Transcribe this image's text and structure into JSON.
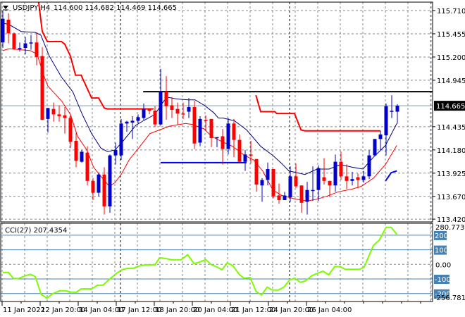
{
  "chart_data": {
    "type": "candlestick",
    "header": {
      "symbol_timeframe": "USDJPY,H4",
      "ohlc_text": "114.600 114.682 114.469 114.665"
    },
    "colors": {
      "bull": "#0000c8",
      "bear": "#ff0000",
      "ma_fast": "#000080",
      "ma_slow": "#ff0000",
      "step_line": "#ff0000",
      "resistance": "#000000",
      "support": "#0000ff",
      "cci": "#7cfc00",
      "cci_levels": "#4682b4",
      "grid": "#7f8a99"
    },
    "price_axis": {
      "range": [
        113.42,
        115.71
      ],
      "ticks": [
        "115.710",
        "115.455",
        "115.200",
        "114.945",
        "114.435",
        "114.180",
        "113.925",
        "113.670",
        "113.420"
      ],
      "tick_values": [
        115.71,
        115.455,
        115.2,
        114.945,
        114.435,
        114.18,
        113.925,
        113.67,
        113.42
      ],
      "current_price": "114.665",
      "current_value": 114.665
    },
    "time_axis": {
      "labels": [
        "11 Jan 2022",
        "12 Jan 20:00",
        "14 Jan 04:00",
        "17 Jan 12:00",
        "18 Jan 20:00",
        "20 Jan 04:00",
        "21 Jan 12:00",
        "24 Jan 20:00",
        "26 Jan 04:00"
      ]
    },
    "candles_ohlc": [
      [
        115.36,
        115.71,
        115.3,
        115.62
      ],
      [
        115.61,
        115.68,
        115.35,
        115.46
      ],
      [
        115.46,
        115.47,
        115.28,
        115.29
      ],
      [
        115.29,
        115.36,
        115.26,
        115.3
      ],
      [
        115.3,
        115.42,
        115.23,
        115.35
      ],
      [
        115.35,
        115.44,
        115.28,
        115.36
      ],
      [
        115.36,
        115.47,
        115.11,
        115.2
      ],
      [
        115.21,
        115.31,
        114.51,
        114.51
      ],
      [
        114.52,
        114.64,
        114.37,
        114.64
      ],
      [
        114.63,
        114.7,
        114.49,
        114.57
      ],
      [
        114.57,
        114.67,
        114.49,
        114.55
      ],
      [
        114.56,
        114.65,
        114.36,
        114.53
      ],
      [
        114.53,
        114.56,
        114.2,
        114.27
      ],
      [
        114.28,
        114.37,
        113.99,
        114.06
      ],
      [
        114.05,
        114.18,
        114.04,
        114.16
      ],
      [
        114.15,
        114.22,
        113.79,
        113.84
      ],
      [
        113.84,
        113.87,
        113.63,
        113.71
      ],
      [
        113.71,
        113.93,
        113.67,
        113.91
      ],
      [
        113.91,
        113.99,
        113.47,
        113.56
      ],
      [
        113.56,
        114.13,
        113.49,
        114.12
      ],
      [
        114.12,
        114.26,
        114.02,
        114.18
      ],
      [
        114.12,
        114.52,
        114.07,
        114.47
      ],
      [
        114.47,
        114.5,
        114.38,
        114.49
      ],
      [
        114.48,
        114.55,
        114.3,
        114.5
      ],
      [
        114.5,
        114.57,
        114.47,
        114.54
      ],
      [
        114.53,
        114.69,
        114.51,
        114.63
      ],
      [
        114.63,
        114.63,
        114.57,
        114.61
      ],
      [
        114.61,
        114.66,
        114.43,
        114.46
      ],
      [
        114.46,
        115.07,
        114.45,
        114.82
      ],
      [
        114.82,
        114.99,
        114.51,
        114.66
      ],
      [
        114.67,
        114.76,
        114.53,
        114.62
      ],
      [
        114.63,
        114.7,
        114.46,
        114.58
      ],
      [
        114.58,
        114.7,
        114.52,
        114.57
      ],
      [
        114.6,
        114.75,
        114.53,
        114.65
      ],
      [
        114.65,
        114.72,
        114.19,
        114.25
      ],
      [
        114.26,
        114.55,
        114.22,
        114.52
      ],
      [
        114.51,
        114.56,
        114.39,
        114.5
      ],
      [
        114.52,
        114.52,
        114.21,
        114.31
      ],
      [
        114.31,
        114.32,
        114.21,
        114.32
      ],
      [
        114.33,
        114.41,
        114.02,
        114.19
      ],
      [
        114.19,
        114.53,
        114.13,
        114.47
      ],
      [
        114.47,
        114.52,
        114.1,
        114.29
      ],
      [
        114.29,
        114.35,
        114.05,
        114.05
      ],
      [
        114.05,
        114.18,
        113.95,
        114.13
      ],
      [
        114.13,
        114.28,
        114.03,
        114.12
      ],
      [
        114.08,
        114.08,
        113.72,
        113.8
      ],
      [
        113.79,
        113.87,
        113.61,
        113.85
      ],
      [
        113.85,
        114.04,
        113.79,
        113.97
      ],
      [
        113.97,
        113.97,
        113.65,
        113.67
      ],
      [
        113.68,
        113.81,
        113.59,
        113.63
      ],
      [
        113.63,
        113.72,
        113.63,
        113.68
      ],
      [
        113.66,
        114.0,
        113.61,
        113.89
      ],
      [
        113.89,
        114.03,
        113.76,
        113.78
      ],
      [
        113.79,
        113.79,
        113.49,
        113.6
      ],
      [
        113.61,
        113.83,
        113.47,
        113.74
      ],
      [
        113.73,
        114.0,
        113.62,
        113.74
      ],
      [
        113.74,
        114.01,
        113.62,
        113.98
      ],
      [
        113.88,
        114.09,
        113.8,
        113.84
      ],
      [
        113.84,
        113.84,
        113.66,
        113.79
      ],
      [
        113.79,
        114.13,
        113.72,
        114.05
      ],
      [
        114.05,
        114.16,
        113.85,
        113.89
      ],
      [
        113.89,
        114.02,
        113.75,
        113.84
      ],
      [
        113.84,
        113.94,
        113.79,
        113.86
      ],
      [
        113.88,
        113.92,
        113.76,
        113.85
      ],
      [
        113.85,
        113.95,
        113.82,
        113.89
      ],
      [
        113.89,
        114.18,
        113.86,
        114.12
      ],
      [
        114.12,
        114.3,
        114.11,
        114.3
      ],
      [
        114.3,
        114.39,
        114.17,
        114.35
      ],
      [
        114.34,
        114.69,
        114.12,
        114.66
      ],
      [
        114.6,
        114.78,
        114.53,
        114.61
      ],
      [
        114.6,
        114.682,
        114.469,
        114.665
      ]
    ],
    "ma_fast": [
      [
        0,
        115.57
      ],
      [
        1,
        115.56
      ],
      [
        3.25,
        115.48
      ],
      [
        5.75,
        115.47
      ],
      [
        6.75,
        115.44
      ],
      [
        8.25,
        115.21
      ],
      [
        10.4,
        114.98
      ],
      [
        12.4,
        114.82
      ],
      [
        14.1,
        114.57
      ],
      [
        15.75,
        114.36
      ],
      [
        17.4,
        114.2
      ],
      [
        18.6,
        114.16
      ],
      [
        19.9,
        114.18
      ],
      [
        21.1,
        114.26
      ],
      [
        23.6,
        114.45
      ],
      [
        24.9,
        114.5
      ],
      [
        27,
        114.57
      ],
      [
        28.25,
        114.69
      ],
      [
        29.1,
        114.76
      ],
      [
        30.75,
        114.74
      ],
      [
        32.9,
        114.73
      ],
      [
        34.1,
        114.73
      ],
      [
        35.75,
        114.67
      ],
      [
        37.4,
        114.59
      ],
      [
        38.25,
        114.53
      ],
      [
        39.1,
        114.53
      ],
      [
        41.1,
        114.5
      ],
      [
        43.25,
        114.4
      ],
      [
        45.75,
        114.22
      ],
      [
        47.9,
        114.12
      ],
      [
        49.5,
        114.03
      ],
      [
        50.75,
        113.95
      ],
      [
        53.6,
        113.91
      ],
      [
        55.75,
        113.97
      ],
      [
        57.9,
        113.97
      ],
      [
        59.9,
        114.02
      ],
      [
        62,
        113.99
      ],
      [
        63.9,
        113.97
      ],
      [
        65.75,
        114.1
      ],
      [
        67.9,
        114.23
      ],
      [
        69.9,
        114.47
      ]
    ],
    "ma_slow": [
      [
        0,
        115.27
      ],
      [
        1.1,
        115.29
      ],
      [
        4.9,
        115.27
      ],
      [
        6.1,
        115.23
      ],
      [
        7.25,
        115.0
      ],
      [
        8,
        114.88
      ],
      [
        10.4,
        114.72
      ],
      [
        12,
        114.57
      ],
      [
        13.25,
        114.33
      ],
      [
        14.9,
        114.18
      ],
      [
        16.1,
        113.99
      ],
      [
        17.4,
        113.89
      ],
      [
        18.9,
        113.78
      ],
      [
        19.9,
        113.82
      ],
      [
        21.1,
        113.92
      ],
      [
        22.4,
        114.07
      ],
      [
        24.1,
        114.2
      ],
      [
        26.1,
        114.36
      ],
      [
        28.25,
        114.41
      ],
      [
        29.5,
        114.44
      ],
      [
        32.4,
        114.47
      ],
      [
        33.6,
        114.46
      ],
      [
        35.75,
        114.41
      ],
      [
        37,
        114.33
      ],
      [
        38.6,
        114.28
      ],
      [
        40.75,
        114.22
      ],
      [
        42.9,
        114.12
      ],
      [
        44.5,
        114.07
      ],
      [
        46.1,
        113.95
      ],
      [
        47.9,
        113.74
      ],
      [
        49.5,
        113.68
      ],
      [
        52,
        113.64
      ],
      [
        54.1,
        113.62
      ],
      [
        55.75,
        113.64
      ],
      [
        57.4,
        113.67
      ],
      [
        59.5,
        113.72
      ],
      [
        62,
        113.75
      ],
      [
        63.6,
        113.78
      ],
      [
        65.75,
        113.87
      ],
      [
        67.9,
        114.02
      ],
      [
        69.9,
        114.23
      ]
    ],
    "step_line_segments": [
      [
        [
          6.3,
          115.83
        ],
        [
          7,
          115.48
        ],
        [
          7.9,
          115.37
        ],
        [
          10.4,
          115.37
        ],
        [
          11,
          115.34
        ],
        [
          12,
          115.21
        ],
        [
          12.9,
          115.0
        ],
        [
          13.9,
          115.0
        ],
        [
          15.75,
          114.75
        ],
        [
          17,
          114.75
        ],
        [
          18,
          114.64
        ],
        [
          18.6,
          114.63
        ],
        [
          26.75,
          114.63
        ]
      ],
      [
        [
          44.9,
          114.78
        ],
        [
          45.75,
          114.6
        ],
        [
          48.25,
          114.6
        ],
        [
          48.6,
          114.58
        ],
        [
          51.75,
          114.58
        ],
        [
          52.9,
          114.4
        ],
        [
          53.6,
          114.39
        ],
        [
          67,
          114.39
        ]
      ]
    ],
    "resistance_line": {
      "price": 114.82,
      "from_index": 24.9
    },
    "support_line": {
      "price": 114.04,
      "from_index": 28,
      "to_index": 43.25
    },
    "short_blue_line": [
      [
        67.9,
        113.84
      ],
      [
        68.9,
        113.93
      ],
      [
        69.9,
        113.95
      ]
    ],
    "cci": {
      "label": "CCI(27) 207.4354",
      "max_label": "280.7737",
      "min_label": "-256.7818",
      "range": [
        -256.7818,
        280.7737
      ],
      "level_labels": [
        "200",
        "100",
        "0.00",
        "-100",
        "-200"
      ],
      "level_values": [
        200,
        100,
        0,
        -100,
        -200
      ],
      "values": [
        [
          0,
          -55
        ],
        [
          1,
          -55
        ],
        [
          1.9,
          -97
        ],
        [
          2.8,
          -97
        ],
        [
          3.9,
          -79
        ],
        [
          4.9,
          -68
        ],
        [
          5.75,
          -84
        ],
        [
          6.8,
          -205
        ],
        [
          7.8,
          -232
        ],
        [
          8.9,
          -200
        ],
        [
          10.1,
          -181
        ],
        [
          11.2,
          -181
        ],
        [
          12,
          -190
        ],
        [
          13,
          -192
        ],
        [
          13.9,
          -168
        ],
        [
          15.75,
          -168
        ],
        [
          16.8,
          -143
        ],
        [
          17.8,
          -142
        ],
        [
          19.1,
          -95
        ],
        [
          20.3,
          -58
        ],
        [
          21.2,
          -36
        ],
        [
          22,
          -28
        ],
        [
          23.25,
          -26
        ],
        [
          24.1,
          -12
        ],
        [
          25.3,
          -3
        ],
        [
          27,
          -3
        ],
        [
          27.8,
          45
        ],
        [
          28.7,
          42
        ],
        [
          29.9,
          32
        ],
        [
          31.6,
          32
        ],
        [
          32.8,
          66
        ],
        [
          33.9,
          6
        ],
        [
          34.7,
          13
        ],
        [
          36,
          32
        ],
        [
          37,
          -2
        ],
        [
          38,
          -18
        ],
        [
          38.9,
          -36
        ],
        [
          39.8,
          10
        ],
        [
          40.75,
          -7
        ],
        [
          42,
          -71
        ],
        [
          42.8,
          -95
        ],
        [
          43.9,
          -90
        ],
        [
          44.9,
          -184
        ],
        [
          45.9,
          -210
        ],
        [
          46.9,
          -156
        ],
        [
          47.8,
          -176
        ],
        [
          48.9,
          -176
        ],
        [
          49.9,
          -155
        ],
        [
          50.9,
          -106
        ],
        [
          51.8,
          -95
        ],
        [
          52.8,
          -123
        ],
        [
          53.7,
          -113
        ],
        [
          54.9,
          -76
        ],
        [
          56.8,
          -47
        ],
        [
          57.8,
          -71
        ],
        [
          58.9,
          -15
        ],
        [
          59.9,
          -16
        ],
        [
          60.75,
          -34
        ],
        [
          63.25,
          -34
        ],
        [
          64.1,
          -19
        ],
        [
          65.75,
          130
        ],
        [
          66.8,
          167
        ],
        [
          68,
          254
        ],
        [
          68.9,
          254
        ],
        [
          69.9,
          207
        ]
      ]
    }
  }
}
